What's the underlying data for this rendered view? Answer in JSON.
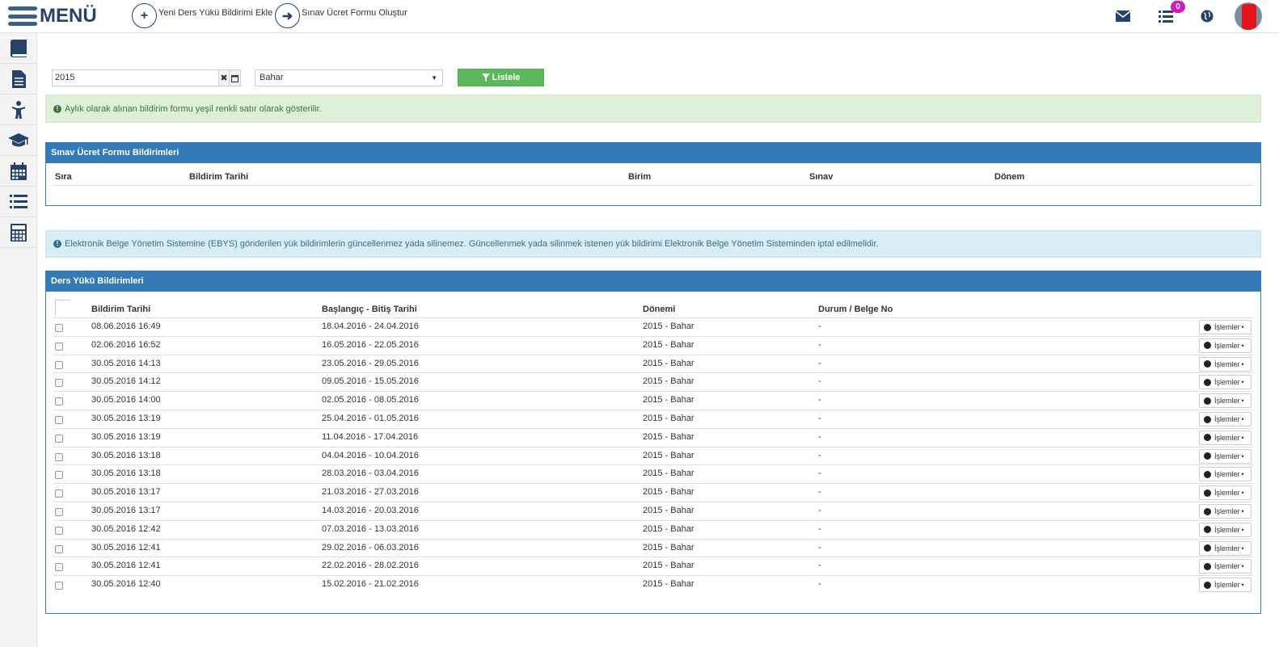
{
  "topbar": {
    "menu_label": "MENÜ",
    "actions": [
      {
        "label": "Yeni Ders Yükü Bildirimi Ekle",
        "icon": "plus-icon"
      },
      {
        "label": "Sınav Ücret Formu Oluştur",
        "icon": "arrow-right-icon"
      }
    ],
    "notification_count": "0",
    "icons": [
      "envelope-icon",
      "list-icon",
      "globe-icon"
    ]
  },
  "sidebar": {
    "items": [
      "book-icon",
      "document-icon",
      "child-icon",
      "graduation-cap-icon",
      "calendar-icon",
      "list-icon",
      "calculator-icon"
    ]
  },
  "filters": {
    "year_value": "2015",
    "term_value": "Bahar",
    "list_button": "Listele"
  },
  "alerts": {
    "green": "Aylık olarak alınan bildirim formu yeşil renkli satır olarak gösterilir.",
    "blue": "Elektronik Belge Yönetim Sistemine (EBYS) gönderilen yük bildirimlerin güncellenmez yada silinemez. Güncellenmek yada silinmek istenen yük bildirimi Elektronik Belge Yönetim Sisteminden iptal edilmelidir."
  },
  "exam_panel": {
    "title": "Sınav Ücret Formu Bildirimleri",
    "columns": [
      "Sıra",
      "Bildirim Tarihi",
      "Birim",
      "Sınav",
      "Dönem"
    ]
  },
  "load_panel": {
    "title": "Ders Yükü Bildirimleri",
    "columns": [
      "Bildirim Tarihi",
      "Başlangıç - Bitiş Tarihi",
      "Dönemi",
      "Durum / Belge No"
    ],
    "ops_label": "İşlemler",
    "rows": [
      {
        "date": "08.06.2016 16:49",
        "range": "18.04.2016 - 24.04.2016",
        "term": "2015 - Bahar",
        "status": "-"
      },
      {
        "date": "02.06.2016 16:52",
        "range": "16.05.2016 - 22.05.2016",
        "term": "2015 - Bahar",
        "status": "-"
      },
      {
        "date": "30.05.2016 14:13",
        "range": "23.05.2016 - 29.05.2016",
        "term": "2015 - Bahar",
        "status": "-"
      },
      {
        "date": "30.05.2016 14:12",
        "range": "09.05.2016 - 15.05.2016",
        "term": "2015 - Bahar",
        "status": "-"
      },
      {
        "date": "30.05.2016 14:00",
        "range": "02.05.2016 - 08.05.2016",
        "term": "2015 - Bahar",
        "status": "-"
      },
      {
        "date": "30.05.2016 13:19",
        "range": "25.04.2016 - 01.05.2016",
        "term": "2015 - Bahar",
        "status": "-"
      },
      {
        "date": "30.05.2016 13:19",
        "range": "11.04.2016 - 17.04.2016",
        "term": "2015 - Bahar",
        "status": "-"
      },
      {
        "date": "30.05.2016 13:18",
        "range": "04.04.2016 - 10.04.2016",
        "term": "2015 - Bahar",
        "status": "-"
      },
      {
        "date": "30.05.2016 13:18",
        "range": "28.03.2016 - 03.04.2016",
        "term": "2015 - Bahar",
        "status": "-"
      },
      {
        "date": "30.05.2016 13:17",
        "range": "21.03.2016 - 27.03.2016",
        "term": "2015 - Bahar",
        "status": "-"
      },
      {
        "date": "30.05.2016 13:17",
        "range": "14.03.2016 - 20.03.2016",
        "term": "2015 - Bahar",
        "status": "-"
      },
      {
        "date": "30.05.2016 12:42",
        "range": "07.03.2016 - 13.03.2016",
        "term": "2015 - Bahar",
        "status": "-"
      },
      {
        "date": "30.05.2016 12:41",
        "range": "29.02.2016 - 06.03.2016",
        "term": "2015 - Bahar",
        "status": "-"
      },
      {
        "date": "30.05.2016 12:41",
        "range": "22.02.2016 - 28.02.2016",
        "term": "2015 - Bahar",
        "status": "-"
      },
      {
        "date": "30.05.2016 12:40",
        "range": "15.02.2016 - 21.02.2016",
        "term": "2015 - Bahar",
        "status": "-"
      }
    ]
  }
}
